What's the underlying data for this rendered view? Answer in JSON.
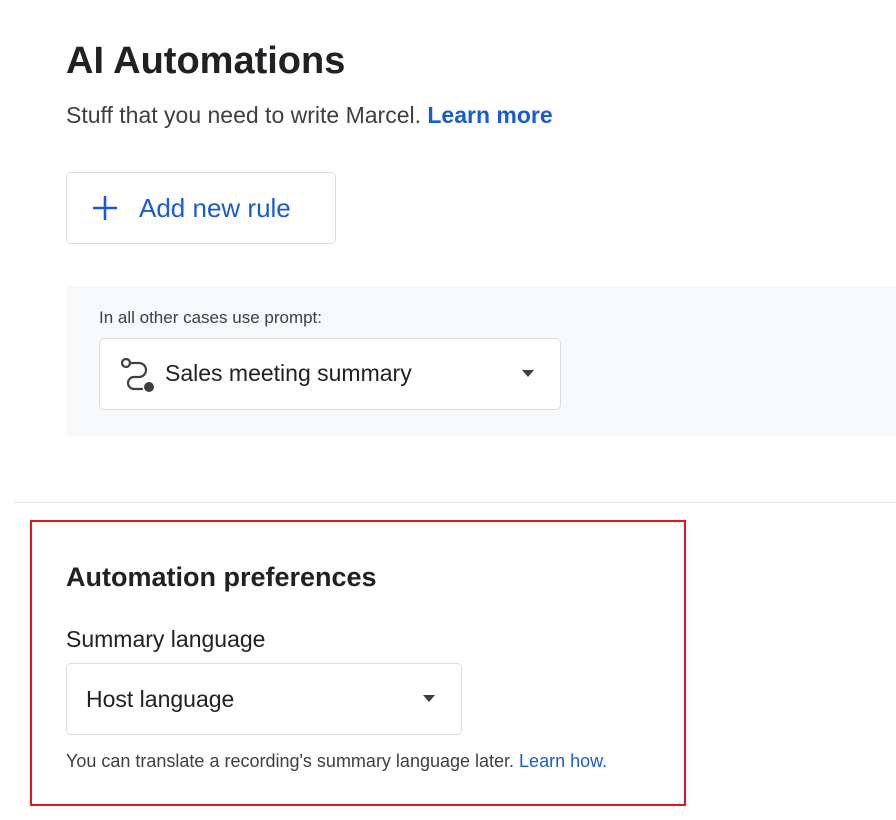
{
  "header": {
    "title": "AI Automations",
    "subtitle": "Stuff that you need to write Marcel.",
    "learn_more": "Learn more"
  },
  "add_rule": {
    "label": "Add new rule",
    "icon": "plus-icon"
  },
  "default_prompt": {
    "label": "In all other cases use prompt:",
    "selected": "Sales meeting summary",
    "icon": "flow-icon"
  },
  "preferences": {
    "title": "Automation preferences",
    "summary_language_label": "Summary language",
    "summary_language_value": "Host language",
    "hint": "You can translate a recording's summary language later.",
    "learn_how": "Learn how."
  },
  "colors": {
    "accent": "#1a5bd1",
    "highlight_border": "#e0161f",
    "panel_bg": "#f7f8fa"
  }
}
